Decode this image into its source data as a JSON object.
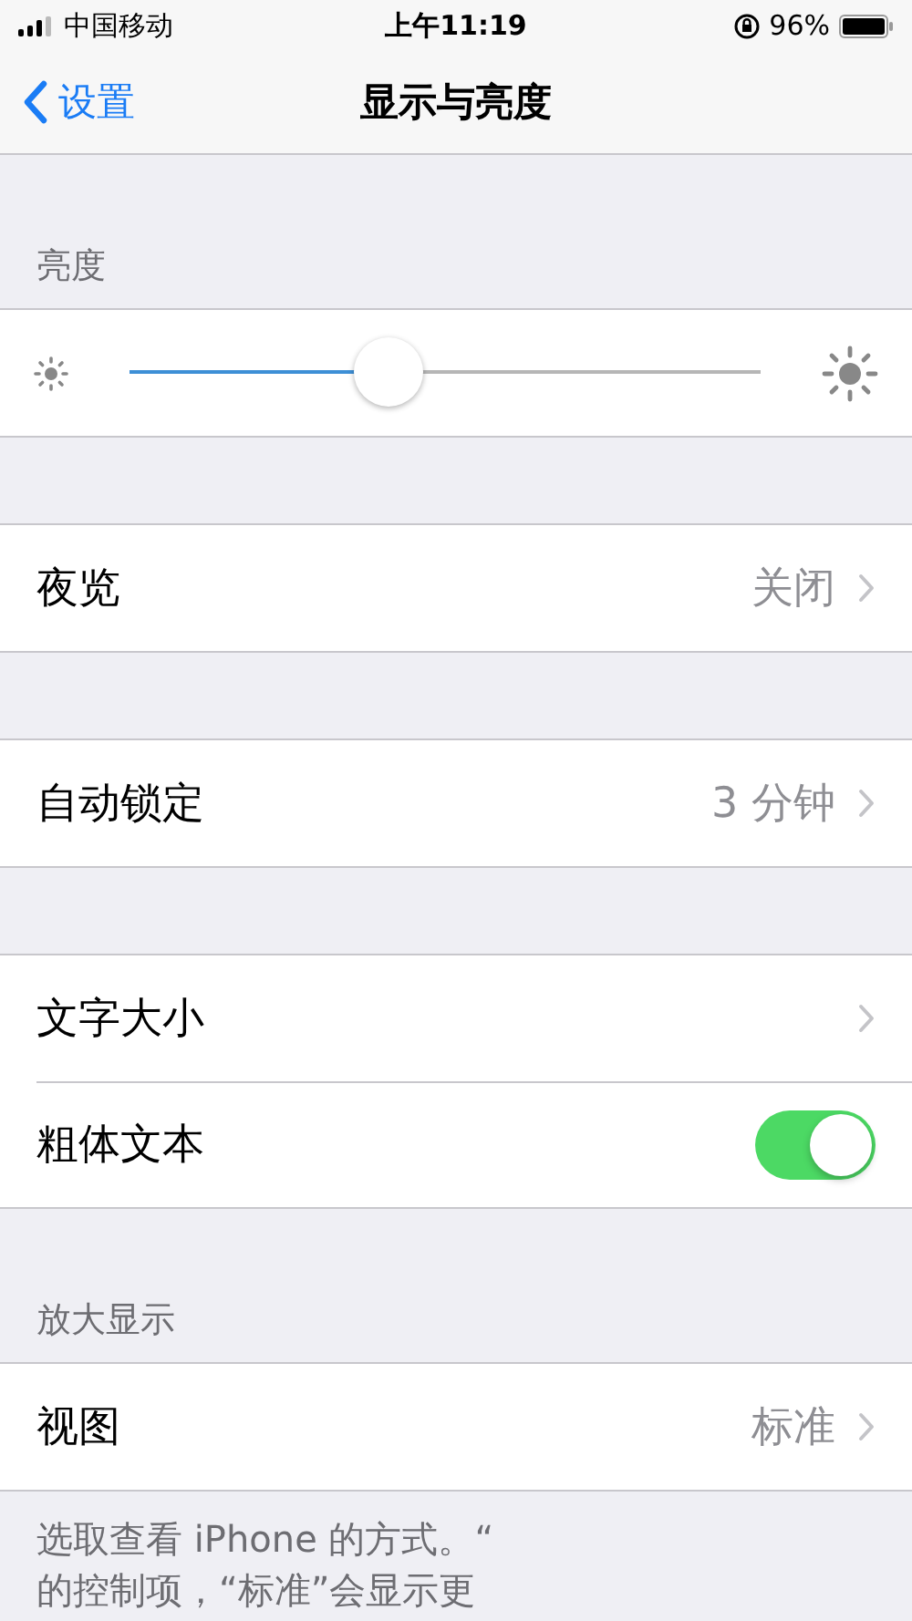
{
  "status_bar": {
    "carrier": "中国移动",
    "time": "上午11:19",
    "battery_percent": "96%"
  },
  "nav": {
    "back": "设置",
    "title": "显示与亮度"
  },
  "sections": [
    {
      "header": "亮度",
      "rows": [
        {
          "kind": "slider",
          "level": 0.41
        }
      ]
    },
    {
      "rows": [
        {
          "kind": "link",
          "label": "夜览",
          "value": "关闭"
        }
      ]
    },
    {
      "rows": [
        {
          "kind": "link",
          "label": "自动锁定",
          "value": "3 分钟"
        }
      ]
    },
    {
      "rows": [
        {
          "kind": "link",
          "label": "文字大小"
        },
        {
          "kind": "toggle",
          "label": "粗体文本",
          "on": true
        }
      ]
    },
    {
      "header": "放大显示",
      "rows": [
        {
          "kind": "link",
          "label": "视图",
          "value": "标准"
        }
      ],
      "footer": [
        "选取查看 iPhone 的方式。“",
        "的控制项，“标准”会显示更"
      ]
    }
  ]
}
